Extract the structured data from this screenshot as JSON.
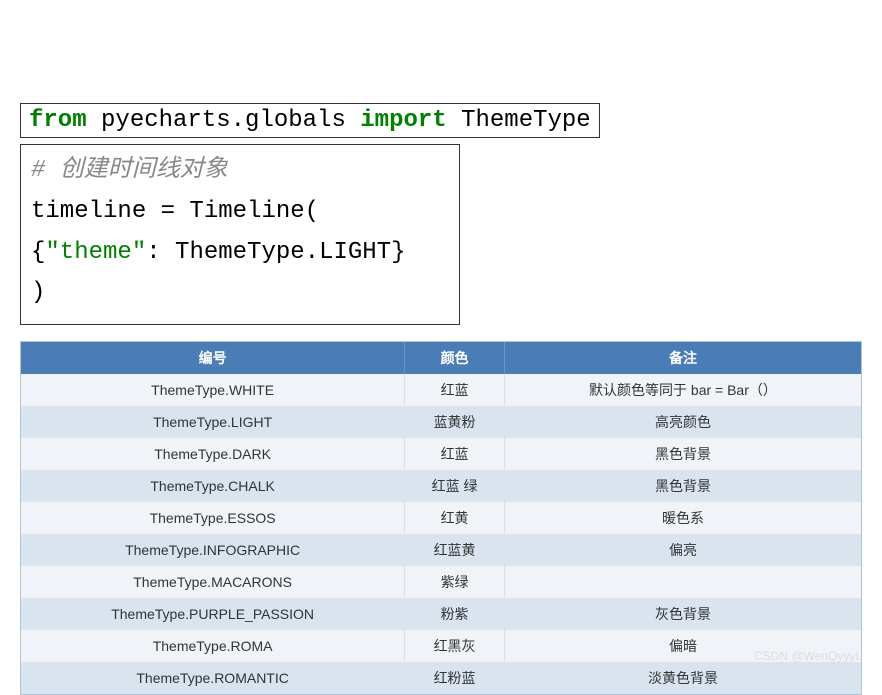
{
  "code_line1": {
    "kw_from": "from",
    "module": " pyecharts.globals ",
    "kw_import": "import",
    "name": " ThemeType"
  },
  "code_block2": {
    "comment": "# 创建时间线对象",
    "line2": "timeline = Timeline(",
    "line3_indent": "    {",
    "line3_key": "\"theme\"",
    "line3_rest": ": ThemeType.LIGHT}",
    "line4": ")"
  },
  "table": {
    "headers": [
      "编号",
      "颜色",
      "备注"
    ],
    "rows": [
      [
        "ThemeType.WHITE",
        "红蓝",
        "默认颜色等同于 bar = Bar（）"
      ],
      [
        "ThemeType.LIGHT",
        "蓝黄粉",
        "高亮颜色"
      ],
      [
        "ThemeType.DARK",
        "红蓝",
        "黑色背景"
      ],
      [
        "ThemeType.CHALK",
        "红蓝 绿",
        "黑色背景"
      ],
      [
        "ThemeType.ESSOS",
        "红黄",
        "暖色系"
      ],
      [
        "ThemeType.INFOGRAPHIC",
        "红蓝黄",
        "偏亮"
      ],
      [
        "ThemeType.MACARONS",
        "紫绿",
        ""
      ],
      [
        "ThemeType.PURPLE_PASSION",
        "粉紫",
        "灰色背景"
      ],
      [
        "ThemeType.ROMA",
        "红黑灰",
        "偏暗"
      ],
      [
        "ThemeType.ROMANTIC",
        "红粉蓝",
        "淡黄色背景"
      ]
    ]
  },
  "watermark": "CSDN @WenQyyyL"
}
